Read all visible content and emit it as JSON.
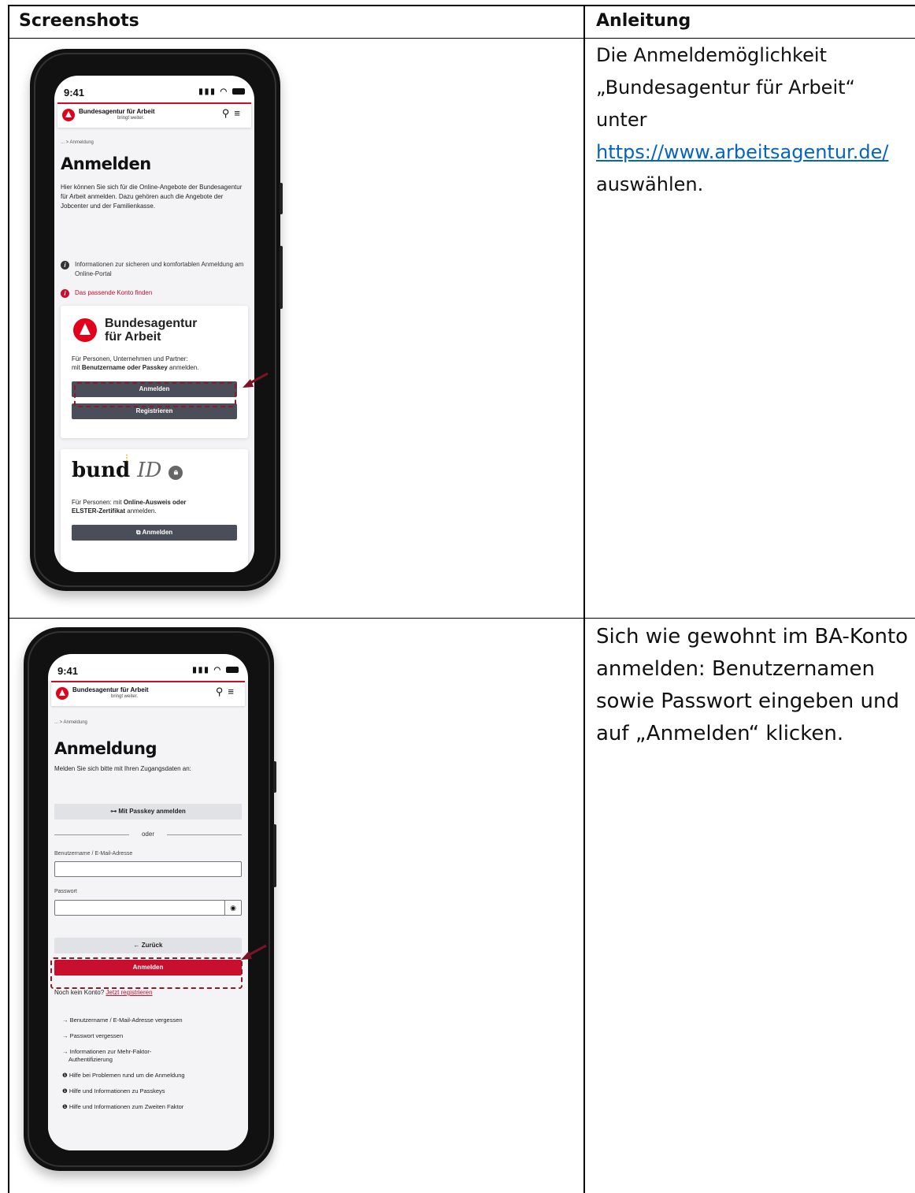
{
  "table": {
    "col1_header": "Screenshots",
    "col2_header": "Anleitung"
  },
  "row1": {
    "instruction_line1": "Die Anmeldemöglichkeit",
    "instruction_line2": "„Bundesagentur für Arbeit“ unter",
    "instruction_link": "https://www.arbeitsagentur.de/",
    "instruction_line3": "auswählen.",
    "phone": {
      "time": "9:41",
      "brand": "Bundesagentur für Arbeit",
      "brand_tagline": "bringt weiter.",
      "breadcrumb": "... > Anmeldung",
      "title": "Anmelden",
      "intro": "Hier können Sie sich für die Online-Angebote der Bundesagentur für Arbeit anmelden. Dazu gehören auch die Angebote der Jobcenter und der Familienkasse.",
      "info1": "Informationen zur sicheren und komfortablen Anmeldung am Online-Portal",
      "info2": "Das passende Konto finden",
      "ba_card_title_1": "Bundesagentur",
      "ba_card_title_2": "für Arbeit",
      "ba_card_text_1": "Für Personen, Unternehmen und Partner:",
      "ba_card_text_2_pre": "mit ",
      "ba_card_text_2_bold": "Benutzername oder Passkey",
      "ba_card_text_2_post": " anmelden.",
      "login_button": "Anmelden",
      "register_button": "Registrieren",
      "bund_word": "bund",
      "bund_id": "ID",
      "bund_text_1_pre": "Für Personen: mit ",
      "bund_text_1_bold": "Online-Ausweis oder",
      "bund_text_2_bold": "ELSTER-Zertifikat",
      "bund_text_2_post": " anmelden.",
      "bund_button": "Anmelden"
    }
  },
  "row2": {
    "instruction_line1": "Sich wie gewohnt im BA-Konto",
    "instruction_line2": "anmelden: Benutzernamen",
    "instruction_line3": "sowie Passwort eingeben und",
    "instruction_line4": "auf „Anmelden“ klicken.",
    "phone": {
      "time": "9:41",
      "brand": "Bundesagentur für Arbeit",
      "brand_tagline": "bringt weiter.",
      "breadcrumb": "... > Anmeldung",
      "title": "Anmeldung",
      "intro": "Melden Sie sich bitte mit Ihren Zugangsdaten an:",
      "passkey_button": "Mit Passkey anmelden",
      "or": "oder",
      "username_label": "Benutzername / E-Mail-Adresse",
      "password_label": "Passwort",
      "back_button": "← Zurück",
      "login_button": "Anmelden",
      "no_account": "Noch kein Konto?",
      "register_link": "Jetzt registrieren",
      "links": [
        "→ Benutzername / E-Mail-Adresse vergessen",
        "→ Passwort vergessen",
        "→ Informationen zur Mehr-Faktor-",
        "Authentifizierung"
      ],
      "help": [
        "Hilfe bei Problemen rund um die Anmeldung",
        "Hilfe und Informationen zu Passkeys",
        "Hilfe und Informationen zum Zweiten Faktor"
      ]
    }
  },
  "colors": {
    "accent_red": "#c8102e",
    "link_blue": "#0563c1",
    "button_dark": "#4a4e58",
    "highlight_dash": "#8b1a2b"
  }
}
